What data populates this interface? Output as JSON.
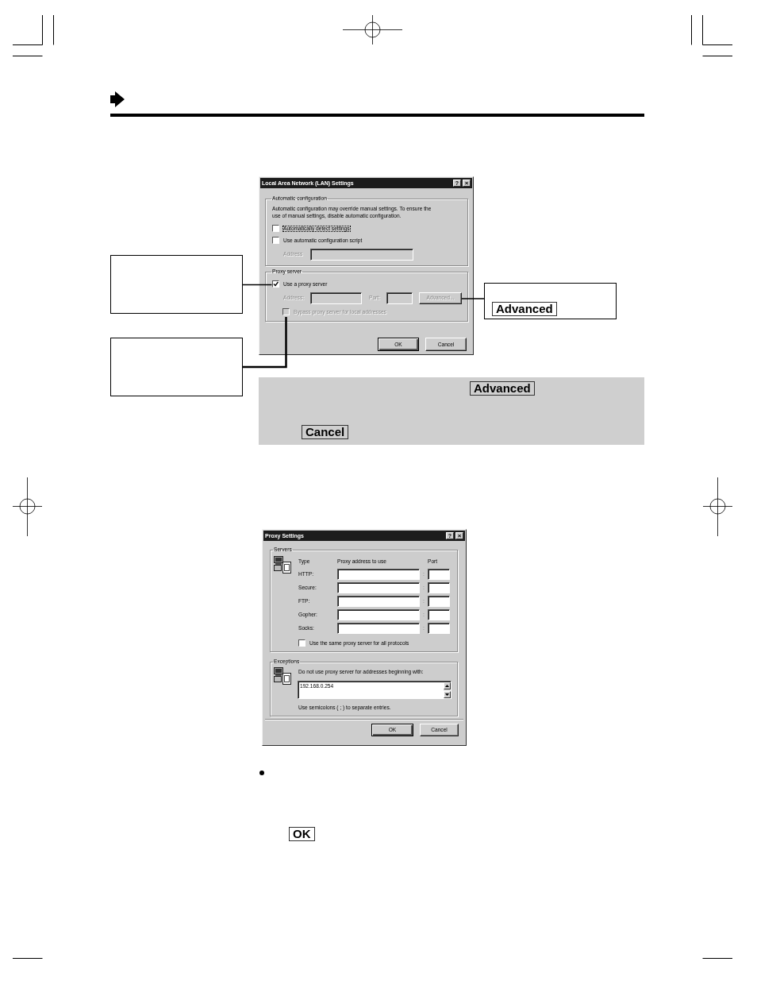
{
  "lan_dialog": {
    "title": "Local Area Network (LAN) Settings",
    "title_buttons": [
      {
        "kind": "help",
        "label": "?"
      },
      {
        "kind": "close",
        "label": "×"
      }
    ],
    "automatic_configuration": {
      "label": "Automatic configuration",
      "description": "Automatic configuration may override manual settings. To ensure the use of manual settings, disable automatic configuration.",
      "checkboxes": [
        {
          "label": "Automatically detect settings",
          "checked": false,
          "disabled": false,
          "focused": true
        },
        {
          "label": "Use automatic configuration script",
          "checked": false,
          "disabled": false,
          "focused": false
        }
      ],
      "address": {
        "label": "Address",
        "disabled": true
      }
    },
    "proxy_server": {
      "label": "Proxy server",
      "use_proxy": {
        "label": "Use a proxy server",
        "checked": true,
        "disabled": false,
        "focused": false
      },
      "address": {
        "label": "Address:",
        "disabled": true
      },
      "port": {
        "label": "Port:",
        "disabled": true
      },
      "advanced_button": {
        "label": "Advanced...",
        "disabled": true
      },
      "bypass": {
        "label": "Bypass proxy server for local addresses",
        "checked": false,
        "disabled": true,
        "focused": false
      }
    },
    "buttons": [
      {
        "label": "OK",
        "default": true
      },
      {
        "label": "Cancel",
        "default": false
      }
    ]
  },
  "advanced_callout": {
    "key_label": "Advanced"
  },
  "note": {
    "key_labels": [
      "Advanced",
      "Cancel"
    ]
  },
  "proxy_dialog": {
    "title": "Proxy Settings",
    "title_buttons": [
      {
        "kind": "help",
        "label": "?"
      },
      {
        "kind": "close",
        "label": "×"
      }
    ],
    "servers": {
      "label": "Servers",
      "columns": [
        "Type",
        "Proxy address to use",
        "Port"
      ],
      "rows": [
        {
          "type": "HTTP:",
          "separator": ":"
        },
        {
          "type": "Secure:",
          "separator": ":"
        },
        {
          "type": "FTP:",
          "separator": ":"
        },
        {
          "type": "Gopher:",
          "separator": ":"
        },
        {
          "type": "Socks:",
          "separator": ":"
        }
      ],
      "same_proxy": {
        "label": "Use the same proxy server for all protocols",
        "checked": false
      }
    },
    "exceptions": {
      "label": "Exceptions",
      "instruction": "Do not use proxy server for addresses beginning with:",
      "value": "192.168.0.254",
      "hint": "Use semicolons ( ; ) to separate entries."
    },
    "buttons": [
      {
        "label": "OK",
        "default": true
      },
      {
        "label": "Cancel",
        "default": false
      }
    ]
  },
  "bullet_item": {
    "key_label": "OK"
  }
}
